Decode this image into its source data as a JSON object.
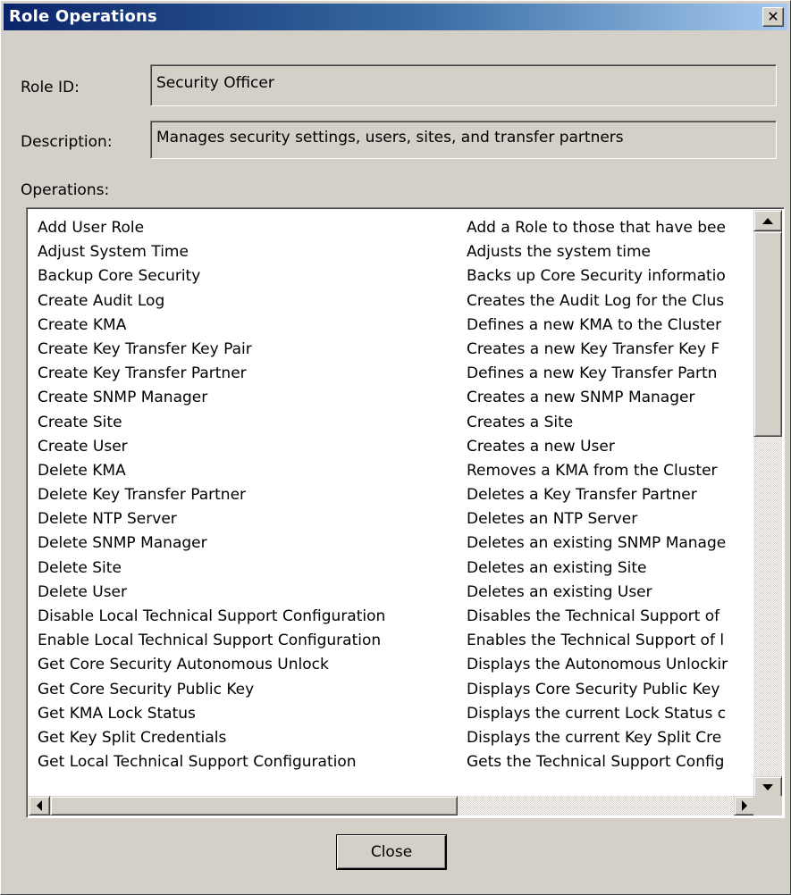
{
  "window": {
    "title": "Role Operations",
    "close_glyph": "✕",
    "title_gradient": [
      "#0a246a",
      "#a6caf0"
    ]
  },
  "form": {
    "role_id_label": "Role ID:",
    "role_id_value": "Security Officer",
    "description_label": "Description:",
    "description_value": "Manages security settings, users, sites, and transfer partners",
    "operations_label": "Operations:"
  },
  "operations": [
    {
      "name": "Add User Role",
      "description": "Add a Role to those that have bee"
    },
    {
      "name": "Adjust System Time",
      "description": "Adjusts the system time"
    },
    {
      "name": "Backup Core Security",
      "description": "Backs up Core Security informatio"
    },
    {
      "name": "Create Audit Log",
      "description": "Creates the Audit Log for the Clus"
    },
    {
      "name": "Create KMA",
      "description": "Defines a new KMA to the Cluster"
    },
    {
      "name": "Create Key Transfer Key Pair",
      "description": "Creates a new Key Transfer Key F"
    },
    {
      "name": "Create Key Transfer Partner",
      "description": "Defines a new Key Transfer Partn"
    },
    {
      "name": "Create SNMP Manager",
      "description": "Creates a new SNMP Manager"
    },
    {
      "name": "Create Site",
      "description": "Creates a Site"
    },
    {
      "name": "Create User",
      "description": "Creates a new User"
    },
    {
      "name": "Delete KMA",
      "description": "Removes a KMA from the Cluster"
    },
    {
      "name": "Delete Key Transfer Partner",
      "description": "Deletes a Key Transfer Partner"
    },
    {
      "name": "Delete NTP Server",
      "description": "Deletes an NTP Server"
    },
    {
      "name": "Delete SNMP Manager",
      "description": "Deletes an existing SNMP Manage"
    },
    {
      "name": "Delete Site",
      "description": "Deletes an existing Site"
    },
    {
      "name": "Delete User",
      "description": "Deletes an existing User"
    },
    {
      "name": "Disable Local Technical Support Configuration",
      "description": "Disables the Technical Support of"
    },
    {
      "name": "Enable Local Technical Support Configuration",
      "description": "Enables the Technical Support of l"
    },
    {
      "name": "Get Core Security Autonomous Unlock",
      "description": "Displays the Autonomous Unlockir"
    },
    {
      "name": "Get Core Security Public Key",
      "description": "Displays Core Security Public Key"
    },
    {
      "name": "Get KMA Lock Status",
      "description": "Displays the current Lock Status c"
    },
    {
      "name": "Get Key Split Credentials",
      "description": "Displays the current Key Split Cre"
    },
    {
      "name": "Get Local Technical Support Configuration",
      "description": "Gets the Technical Support Config"
    }
  ],
  "buttons": {
    "close_label": "Close"
  },
  "icons": {
    "window_close": "close-icon",
    "scroll_up": "arrow-up-icon",
    "scroll_down": "arrow-down-icon",
    "scroll_left": "arrow-left-icon",
    "scroll_right": "arrow-right-icon"
  }
}
